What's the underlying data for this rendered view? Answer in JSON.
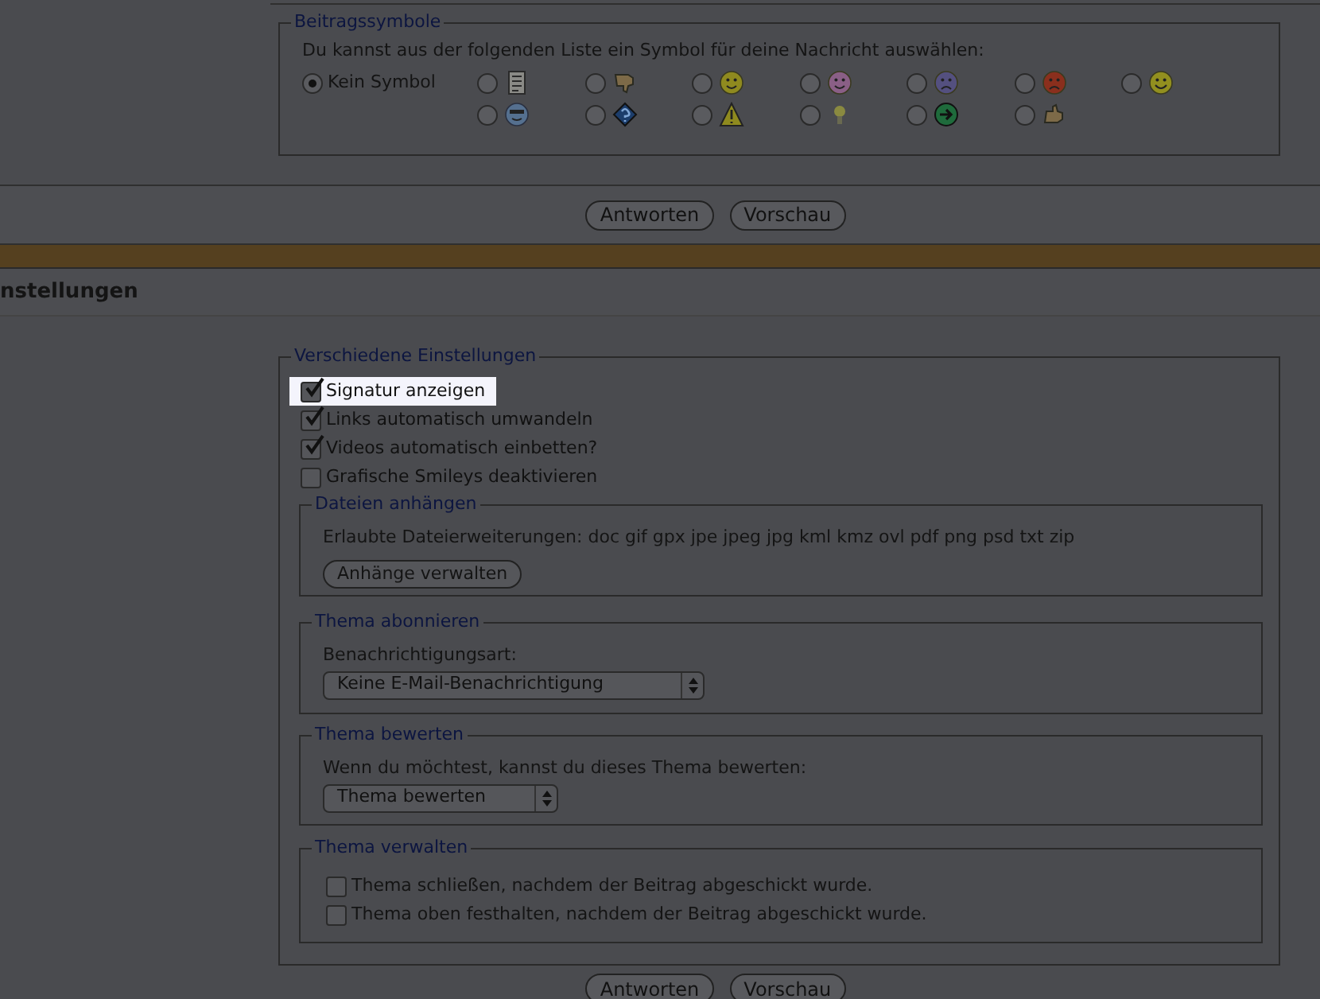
{
  "symbols": {
    "legend": "Beitragssymbole",
    "intro": "Du kannst aus der folgenden Liste ein Symbol für deine Nachricht auswählen:",
    "options": [
      {
        "kind": "none",
        "label": "Kein Symbol",
        "selected": true
      },
      {
        "kind": "document",
        "selected": false
      },
      {
        "kind": "thumbs-down",
        "selected": false
      },
      {
        "kind": "smile",
        "selected": false
      },
      {
        "kind": "grin",
        "selected": false
      },
      {
        "kind": "sad",
        "selected": false
      },
      {
        "kind": "angry",
        "selected": false
      },
      {
        "kind": "happy",
        "selected": false
      },
      {
        "kind": "cool",
        "selected": false
      },
      {
        "kind": "question",
        "selected": false
      },
      {
        "kind": "warning",
        "selected": false
      },
      {
        "kind": "idea",
        "selected": false
      },
      {
        "kind": "arrow",
        "selected": false
      },
      {
        "kind": "thumbs-up",
        "selected": false
      }
    ]
  },
  "buttons_top": [
    "Antworten",
    "Vorschau"
  ],
  "section_heading": "nstellungen",
  "settings": {
    "legend": "Verschiedene Einstellungen",
    "checkboxes": [
      {
        "label": "Signatur anzeigen",
        "checked": true,
        "highlighted": true
      },
      {
        "label": "Links automatisch umwandeln",
        "checked": true,
        "highlighted": false
      },
      {
        "label": "Videos automatisch einbetten?",
        "checked": true,
        "highlighted": false
      },
      {
        "label": "Grafische Smileys deaktivieren",
        "checked": false,
        "highlighted": false
      }
    ],
    "attachments": {
      "legend": "Dateien anhängen",
      "text": "Erlaubte Dateierweiterungen: doc gif gpx jpe jpeg jpg kml kmz ovl pdf png psd txt zip",
      "button": "Anhänge verwalten"
    },
    "subscribe": {
      "legend": "Thema abonnieren",
      "label": "Benachrichtigungsart:",
      "select": "Keine E-Mail-Benachrichtigung"
    },
    "rate": {
      "legend": "Thema bewerten",
      "label": "Wenn du möchtest, kannst du dieses Thema bewerten:",
      "select": "Thema bewerten"
    },
    "manage": {
      "legend": "Thema verwalten",
      "checkboxes": [
        {
          "label": "Thema schließen, nachdem der Beitrag abgeschickt wurde.",
          "checked": false
        },
        {
          "label": "Thema oben festhalten, nachdem der Beitrag abgeschickt wurde.",
          "checked": false
        }
      ]
    }
  },
  "buttons_bottom": [
    "Antworten",
    "Vorschau"
  ]
}
